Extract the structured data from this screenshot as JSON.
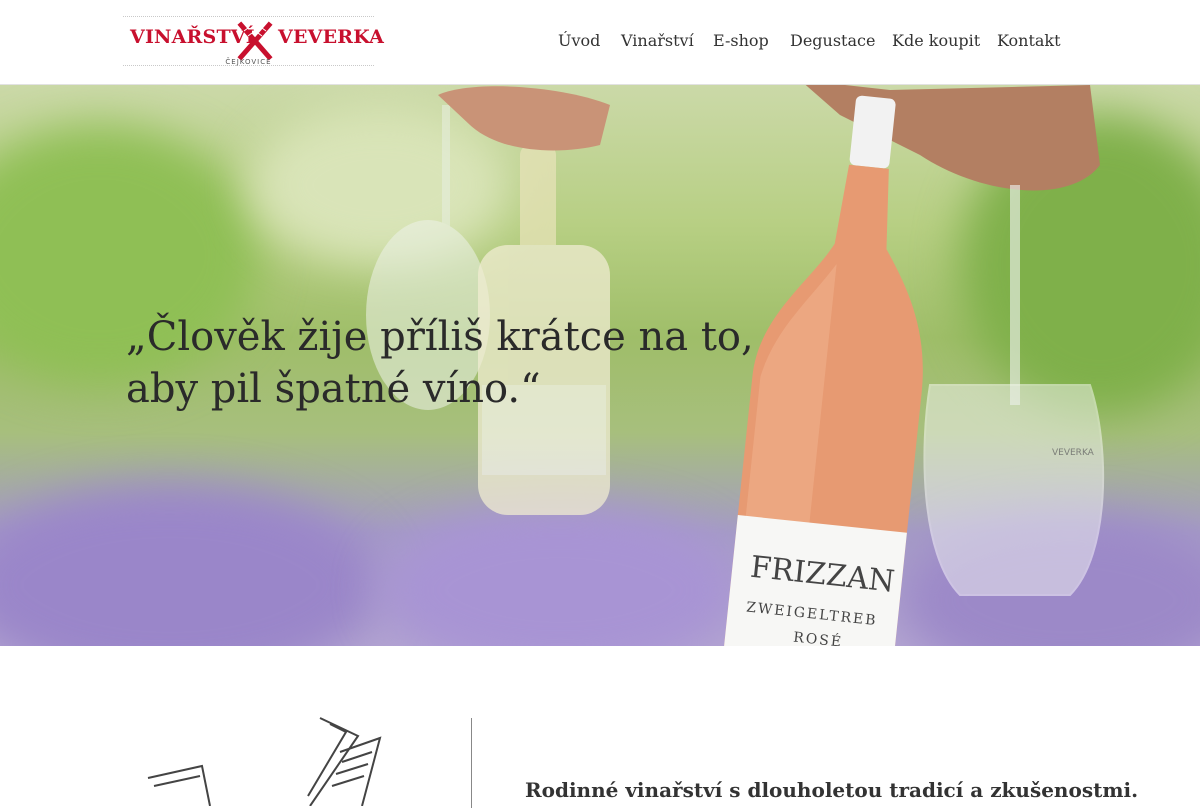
{
  "header": {
    "logo": {
      "left_text": "VINAŘSTVÍ",
      "right_text": "VEVERKA",
      "sub_text": "ČEJKOVICE",
      "brand_color": "#c8102e"
    },
    "nav": [
      {
        "label": "Úvod"
      },
      {
        "label": "Vinařství"
      },
      {
        "label": "E-shop"
      },
      {
        "label": "Degustace"
      },
      {
        "label": "Kde koupit"
      },
      {
        "label": "Kontakt"
      }
    ]
  },
  "hero": {
    "quote_line1": "„Člověk žije příliš krátce na to,",
    "quote_line2": "aby pil špatné víno.“",
    "image": {
      "label_title": "FRIZZAN",
      "label_variety": "ZWEIGELTREB",
      "label_type": "ROSÉ",
      "glass_engraving": "VEVERKA"
    }
  },
  "intro": {
    "heading": "Rodinné vinařství s dlouholetou tradicí a zkušenostmi."
  }
}
